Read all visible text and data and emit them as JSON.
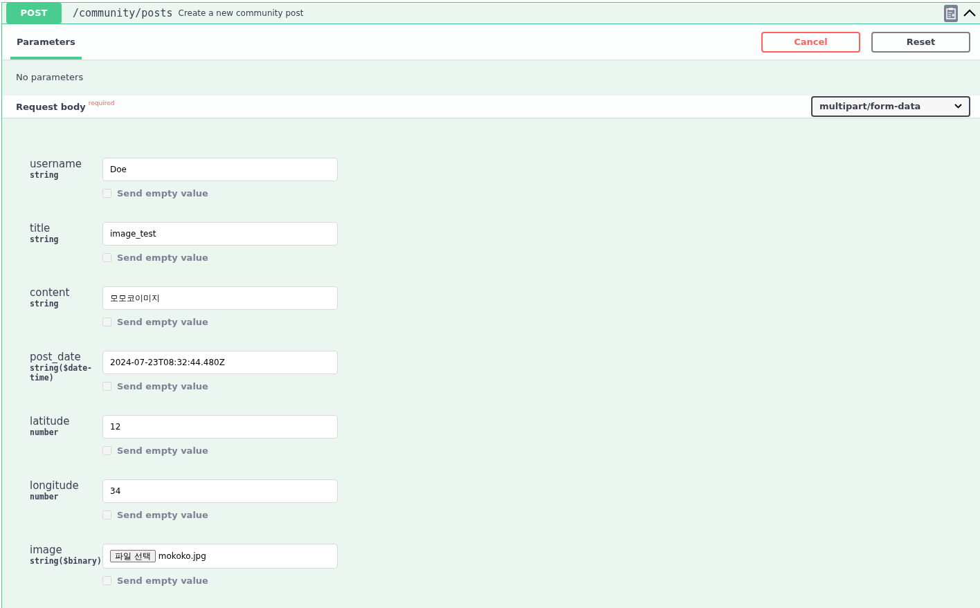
{
  "operation": {
    "method": "POST",
    "path": "/community/posts",
    "summary": "Create a new community post",
    "expanded": true
  },
  "tabs": [
    {
      "label": "Parameters",
      "selected": true
    }
  ],
  "buttons": [
    {
      "label": "Cancel",
      "kind": "cancel"
    },
    {
      "label": "Reset",
      "kind": "reset"
    }
  ],
  "parameters_message": "No parameters",
  "request_body": {
    "title": "Request body",
    "required_label": "required",
    "content_type": "multipart/form-data"
  },
  "fields": [
    {
      "name": "username",
      "type": "string",
      "kind": "text",
      "value": "Doe",
      "send_empty": {
        "label": "Send empty value",
        "checked": false
      }
    },
    {
      "name": "title",
      "type": "string",
      "kind": "text",
      "value": "image_test",
      "send_empty": {
        "label": "Send empty value",
        "checked": false
      }
    },
    {
      "name": "content",
      "type": "string",
      "kind": "text",
      "value": "모모코이미지",
      "send_empty": {
        "label": "Send empty value",
        "checked": false
      }
    },
    {
      "name": "post_date",
      "type": "string($date-time)",
      "kind": "text",
      "value": "2024-07-23T08:32:44.480Z",
      "send_empty": {
        "label": "Send empty value",
        "checked": false
      }
    },
    {
      "name": "latitude",
      "type": "number",
      "kind": "text",
      "value": "12",
      "send_empty": {
        "label": "Send empty value",
        "checked": false
      }
    },
    {
      "name": "longitude",
      "type": "number",
      "kind": "text",
      "value": "34",
      "send_empty": {
        "label": "Send empty value",
        "checked": false
      }
    },
    {
      "name": "image",
      "type": "string($binary)",
      "kind": "file",
      "button_label": "파일 선택",
      "value": "mokoko.jpg",
      "send_empty": {
        "label": "Send empty value",
        "checked": false
      }
    }
  ]
}
